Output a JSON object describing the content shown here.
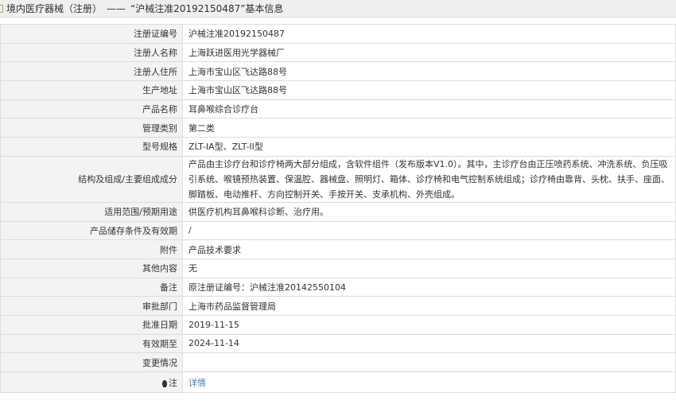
{
  "header": {
    "category": "境内医疗器械（注册）",
    "separator": "——",
    "title": "“沪械注准20192150487”基本信息"
  },
  "rows": [
    {
      "label": "注册证编号",
      "value": "沪械注准20192150487"
    },
    {
      "label": "注册人名称",
      "value": "上海跃进医用光学器械厂"
    },
    {
      "label": "注册人住所",
      "value": "上海市宝山区飞达路88号"
    },
    {
      "label": "生产地址",
      "value": "上海市宝山区飞达路88号"
    },
    {
      "label": "产品名称",
      "value": "耳鼻喉综合诊疗台"
    },
    {
      "label": "管理类别",
      "value": "第二类"
    },
    {
      "label": "型号规格",
      "value": "ZLT-IA型、ZLT-II型"
    },
    {
      "label": "结构及组成/主要组成成分",
      "value": "产品由主诊疗台和诊疗椅两大部分组成，含软件组件（发布版本V1.0）。其中，主诊疗台由正压喷药系统、冲洗系统、负压吸引系统、喉镜预热装置、保温腔、器械盘、照明灯、箱体、诊疗椅和电气控制系统组成；诊疗椅由靠背、头枕、扶手、座面、脚踏板、电动推杆、方向控制开关、手按开关、支承机构、外壳组成。"
    },
    {
      "label": "适用范围/预期用途",
      "value": "供医疗机构耳鼻喉科诊断、治疗用。"
    },
    {
      "label": "产品储存条件及有效期",
      "value": "/"
    },
    {
      "label": "附件",
      "value": "产品技术要求"
    },
    {
      "label": "其他内容",
      "value": "无"
    },
    {
      "label": "备注",
      "value": "原注册证编号：沪械注准20142550104"
    },
    {
      "label": "审批部门",
      "value": "上海市药品监督管理局"
    },
    {
      "label": "批准日期",
      "value": "2019-11-15"
    },
    {
      "label": "有效期至",
      "value": "2024-11-14"
    },
    {
      "label": "变更情况",
      "value": ""
    },
    {
      "label": "注",
      "value": "详情"
    }
  ],
  "icons": {
    "note_icon": "lightbulb-icon",
    "header_icon": "document-icon"
  },
  "colors": {
    "link": "#4a78b8",
    "label_bg": "#f3f3f3",
    "border": "#dcdcdc",
    "header_bg": "#efefef"
  }
}
